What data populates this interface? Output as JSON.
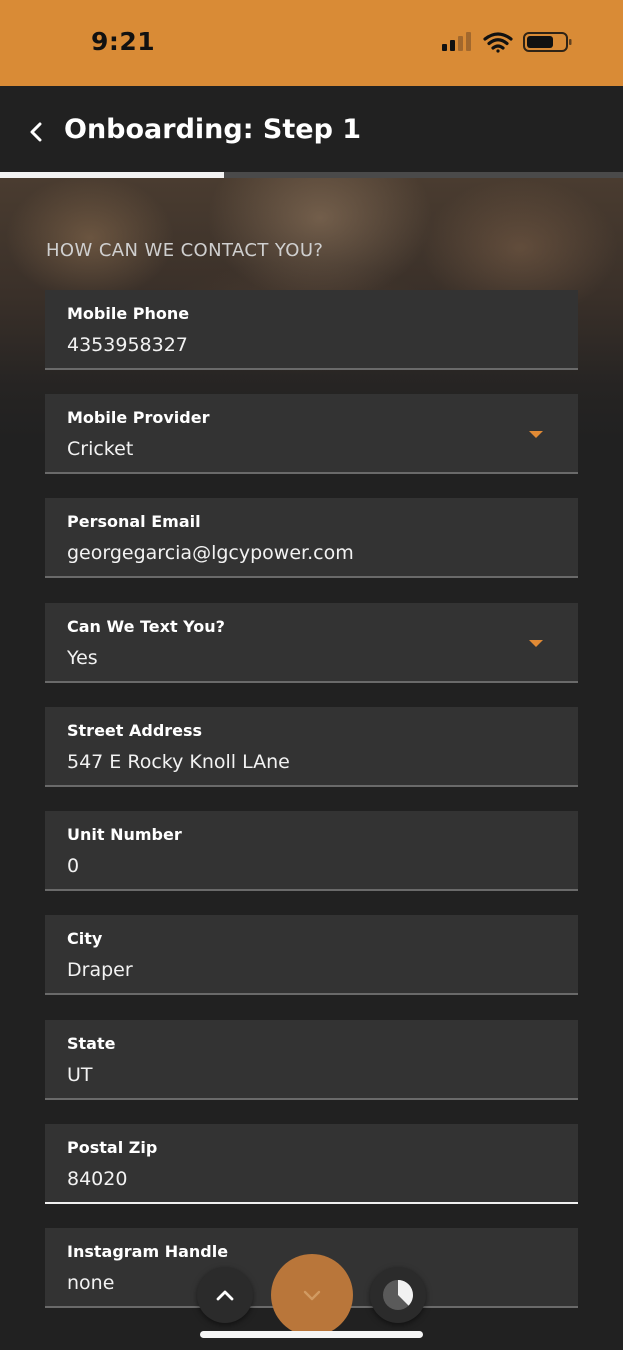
{
  "status_bar": {
    "time": "9:21",
    "background_color": "#d98b36",
    "icons": [
      "cellular-signal-icon",
      "wifi-icon",
      "battery-icon"
    ]
  },
  "header": {
    "title": "Onboarding: Step 1",
    "back_icon": "chevron-left-icon"
  },
  "progress": {
    "fraction": 0.36
  },
  "section": {
    "title": "HOW CAN WE CONTACT YOU?"
  },
  "fields": {
    "mobile_phone": {
      "label": "Mobile Phone",
      "value": "4353958327"
    },
    "mobile_provider": {
      "label": "Mobile Provider",
      "value": "Cricket"
    },
    "personal_email": {
      "label": "Personal Email",
      "value": "georgegarcia@lgcypower.com"
    },
    "can_text": {
      "label": "Can We Text You?",
      "value": "Yes"
    },
    "street_address": {
      "label": "Street Address",
      "value": "547 E Rocky Knoll LAne"
    },
    "unit_number": {
      "label": "Unit Number",
      "value": "0"
    },
    "city": {
      "label": "City",
      "value": "Draper"
    },
    "state": {
      "label": "State",
      "value": "UT"
    },
    "postal_zip": {
      "label": "Postal Zip",
      "value": "84020"
    },
    "instagram_handle": {
      "label": "Instagram Handle",
      "value": "none"
    }
  },
  "floating_actions": {
    "up_icon": "chevron-up-icon",
    "down_icon": "chevron-down-icon",
    "pie_icon": "pie-chart-icon"
  },
  "colors": {
    "accent": "#e08a35",
    "background": "#212121",
    "field_background": "#333333"
  }
}
